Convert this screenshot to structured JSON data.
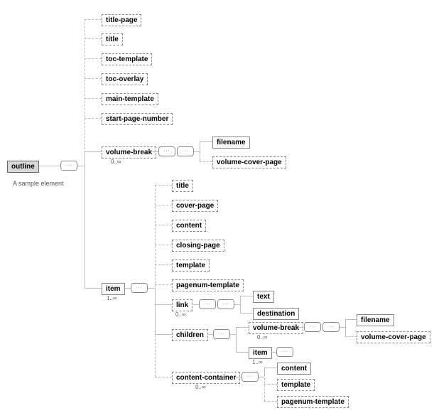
{
  "root": {
    "label": "outline",
    "caption": "A sample element"
  },
  "level1": {
    "titlePage": "title-page",
    "title": "title",
    "tocTemplate": "toc-template",
    "tocOverlay": "toc-overlay",
    "mainTemplate": "main-template",
    "startPageNumber": "start-page-number",
    "volumeBreak": {
      "label": "volume-break",
      "card": "0..∞"
    },
    "item": {
      "label": "item",
      "card": "1..∞"
    }
  },
  "volumeBreakChildren": {
    "filename": "filename",
    "volumeCoverPage": "volume-cover-page"
  },
  "itemChildren": {
    "title": "title",
    "coverPage": "cover-page",
    "content": "content",
    "closingPage": "closing-page",
    "template": "template",
    "pagenumTemplate": "pagenum-template",
    "link": {
      "label": "link",
      "card": "0..∞"
    },
    "children": {
      "label": "children"
    },
    "contentContainer": {
      "label": "content-container",
      "card": "0..∞"
    }
  },
  "linkChildren": {
    "text": "text",
    "destination": "destination"
  },
  "childrenChildren": {
    "volumeBreak": {
      "label": "volume-break",
      "card": "0..∞"
    },
    "item": {
      "label": "item",
      "card": "1..∞"
    },
    "filename": "filename",
    "volumeCoverPage": "volume-cover-page"
  },
  "contentContainerChildren": {
    "content": "content",
    "template": "template",
    "pagenumTemplate": "pagenum-template"
  }
}
